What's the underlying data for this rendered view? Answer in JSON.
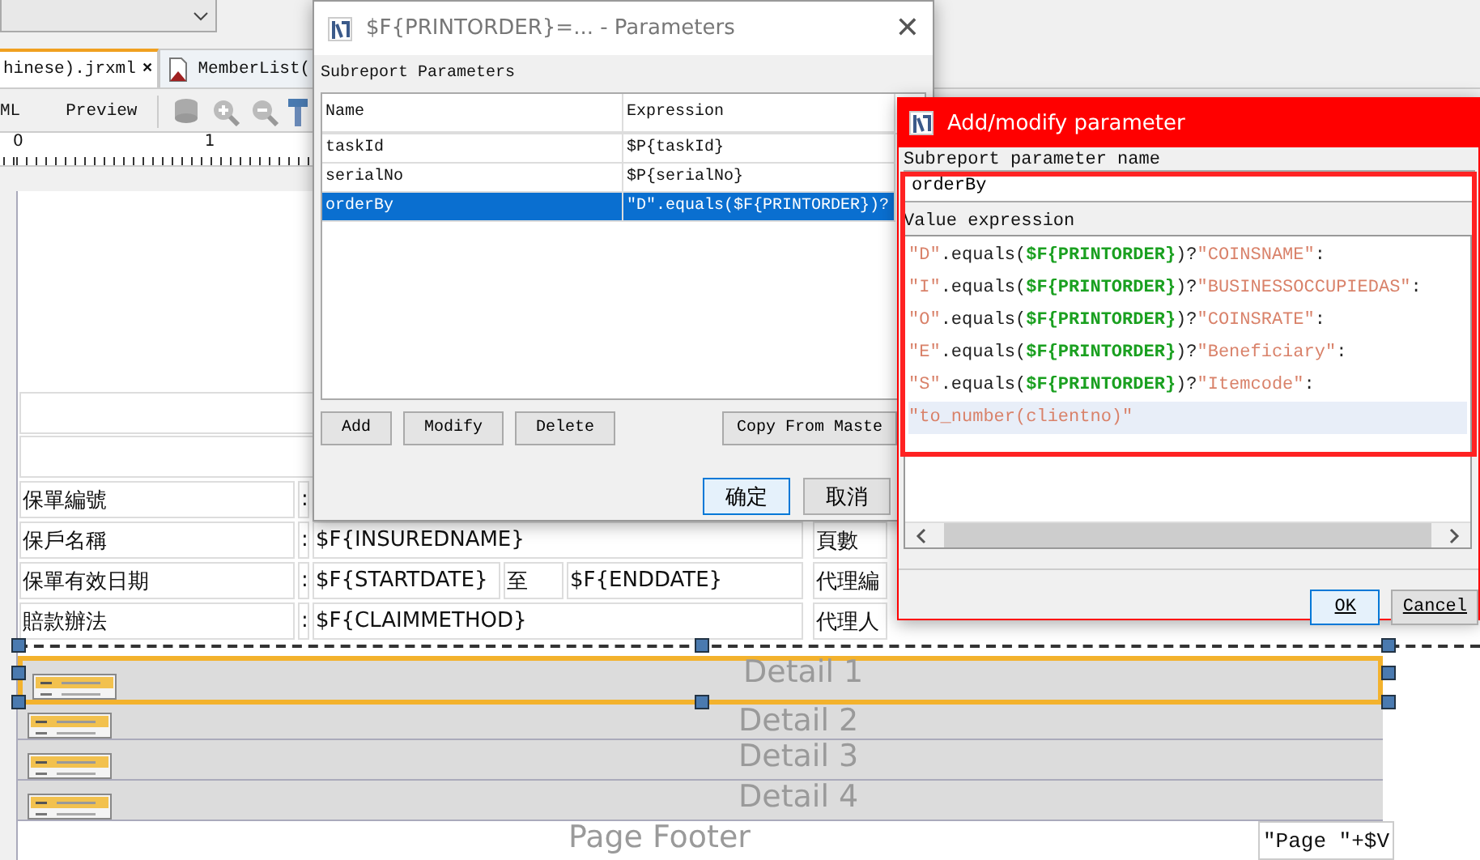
{
  "designer": {
    "tabs": [
      {
        "label": "hinese).jrxml",
        "close": "×",
        "selected": true
      },
      {
        "label": "MemberList(",
        "selected": false
      }
    ],
    "views": [
      {
        "label": "ML",
        "selected": false
      },
      {
        "label": "Preview",
        "selected": false
      }
    ],
    "ruler": [
      "0",
      "1"
    ],
    "form_rows": [
      {
        "label": "保單編號",
        "colon": ":"
      },
      {
        "label": "保戶名稱",
        "colon": ":",
        "values": [
          "$F{INSUREDNAME}"
        ],
        "right": "頁數"
      },
      {
        "label": "保單有效日期",
        "colon": ":",
        "values": [
          "$F{STARTDATE}",
          "至",
          "$F{ENDDATE}"
        ],
        "right": "代理編"
      },
      {
        "label": "賠款辦法",
        "colon": ":",
        "values": [
          "$F{CLAIMMETHOD}"
        ],
        "right": "代理人"
      }
    ],
    "bands": [
      {
        "label": "Detail 1",
        "selected": true,
        "kind": "detail"
      },
      {
        "label": "Detail 2",
        "selected": false,
        "kind": "detail"
      },
      {
        "label": "Detail 3",
        "selected": false,
        "kind": "detail"
      },
      {
        "label": "Detail 4",
        "selected": false,
        "kind": "detail"
      },
      {
        "label": "Page Footer",
        "selected": false,
        "kind": "footer",
        "field": "\"Page \"+$V"
      }
    ]
  },
  "parameters_dialog": {
    "title": "$F{PRINTORDER}=... - Parameters",
    "close": "✕",
    "section": "Subreport Parameters",
    "columns": [
      "Name",
      "Expression"
    ],
    "rows": [
      {
        "name": "taskId",
        "expression": "$P{taskId}",
        "selected": false
      },
      {
        "name": "serialNo",
        "expression": "$P{serialNo}",
        "selected": false
      },
      {
        "name": "orderBy",
        "expression": "\"D\".equals($F{PRINTORDER})?",
        "selected": true
      }
    ],
    "buttons": [
      "Add",
      "Modify",
      "Delete",
      "Copy From Maste"
    ],
    "ok": "确定",
    "cancel": "取消"
  },
  "modify_dialog": {
    "title": "Add/modify parameter",
    "name_label": "Subreport parameter name",
    "name_value": "orderBy",
    "expression_label": "Value expression",
    "lines": [
      {
        "current": false,
        "tokens": [
          {
            "kind": "str",
            "text": "\"D\""
          },
          {
            "kind": "plain",
            "text": ".equals("
          },
          {
            "kind": "field",
            "text": "$F{PRINTORDER}"
          },
          {
            "kind": "plain",
            "text": ")?"
          },
          {
            "kind": "str",
            "text": "\"COINSNAME\""
          },
          {
            "kind": "plain",
            "text": ":"
          }
        ]
      },
      {
        "current": false,
        "tokens": [
          {
            "kind": "str",
            "text": "\"I\""
          },
          {
            "kind": "plain",
            "text": ".equals("
          },
          {
            "kind": "field",
            "text": "$F{PRINTORDER}"
          },
          {
            "kind": "plain",
            "text": ")?"
          },
          {
            "kind": "str",
            "text": "\"BUSINESSOCCUPIEDAS\""
          },
          {
            "kind": "plain",
            "text": ":"
          }
        ]
      },
      {
        "current": false,
        "tokens": [
          {
            "kind": "str",
            "text": "\"O\""
          },
          {
            "kind": "plain",
            "text": ".equals("
          },
          {
            "kind": "field",
            "text": "$F{PRINTORDER}"
          },
          {
            "kind": "plain",
            "text": ")?"
          },
          {
            "kind": "str",
            "text": "\"COINSRATE\""
          },
          {
            "kind": "plain",
            "text": ":"
          }
        ]
      },
      {
        "current": false,
        "tokens": [
          {
            "kind": "str",
            "text": "\"E\""
          },
          {
            "kind": "plain",
            "text": ".equals("
          },
          {
            "kind": "field",
            "text": "$F{PRINTORDER}"
          },
          {
            "kind": "plain",
            "text": ")?"
          },
          {
            "kind": "str",
            "text": "\"Beneficiary\""
          },
          {
            "kind": "plain",
            "text": ":"
          }
        ]
      },
      {
        "current": false,
        "tokens": [
          {
            "kind": "str",
            "text": "\"S\""
          },
          {
            "kind": "plain",
            "text": ".equals("
          },
          {
            "kind": "field",
            "text": "$F{PRINTORDER}"
          },
          {
            "kind": "plain",
            "text": ")?"
          },
          {
            "kind": "str",
            "text": "\"Itemcode\""
          },
          {
            "kind": "plain",
            "text": ":"
          }
        ]
      },
      {
        "current": true,
        "tokens": [
          {
            "kind": "str",
            "text": "\"to_number(clientno)\""
          }
        ]
      }
    ],
    "ok": "OK",
    "cancel": "Cancel"
  }
}
